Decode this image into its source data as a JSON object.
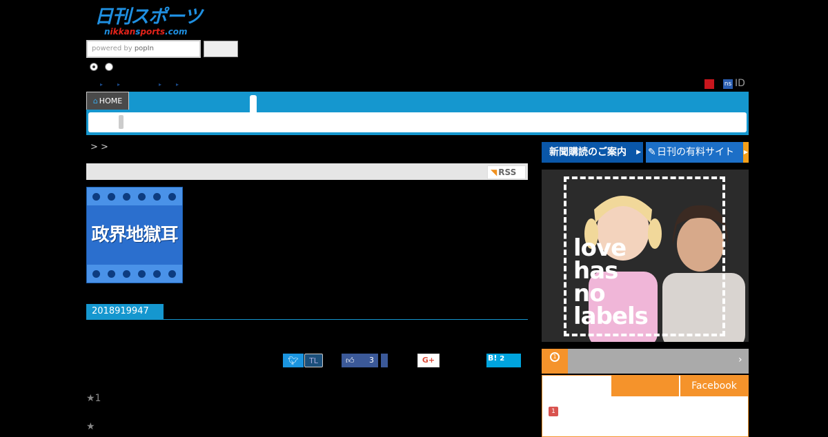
{
  "logo": {
    "title_jp": "日刊スポーツ",
    "domain_blue_1": "n",
    "domain_red_1": "ikkan",
    "domain_blue_2": "s",
    "domain_red_2": "ports",
    "domain_suffix": ".com"
  },
  "search": {
    "placeholder_prefix": "powered by ",
    "placeholder_brand": "popIn"
  },
  "header": {
    "ns_badge": "ns",
    "id_label": "ID"
  },
  "nav": {
    "home_label": "HOME"
  },
  "breadcrumb": {
    "text": ">  >"
  },
  "feed": {
    "rss_label": "RSS"
  },
  "article": {
    "thumb_caption": "政界地獄耳",
    "date": "2018919947",
    "stars_1": "★1",
    "stars_2": "★"
  },
  "social": {
    "twitter_icon": "twitter-icon",
    "tl_label": "TL",
    "facebook_count": "3",
    "gplus_label": "G+",
    "hatena_label": "B!",
    "hatena_count": "2"
  },
  "sidebar": {
    "subscribe_label": "新聞購読のご案内",
    "paid_site_label": "日刊の有料サイト",
    "ad_text_line1": "love",
    "ad_text_line2": "has",
    "ad_text_line3": "no",
    "ad_text_line4": "labels",
    "ranking_badge": "1",
    "ranking_tab_facebook": "Facebook",
    "ranking_first": "1"
  },
  "colors": {
    "brand_blue": "#1597cf",
    "accent_orange": "#f5932b",
    "nav_dark": "#4a4a4a"
  }
}
